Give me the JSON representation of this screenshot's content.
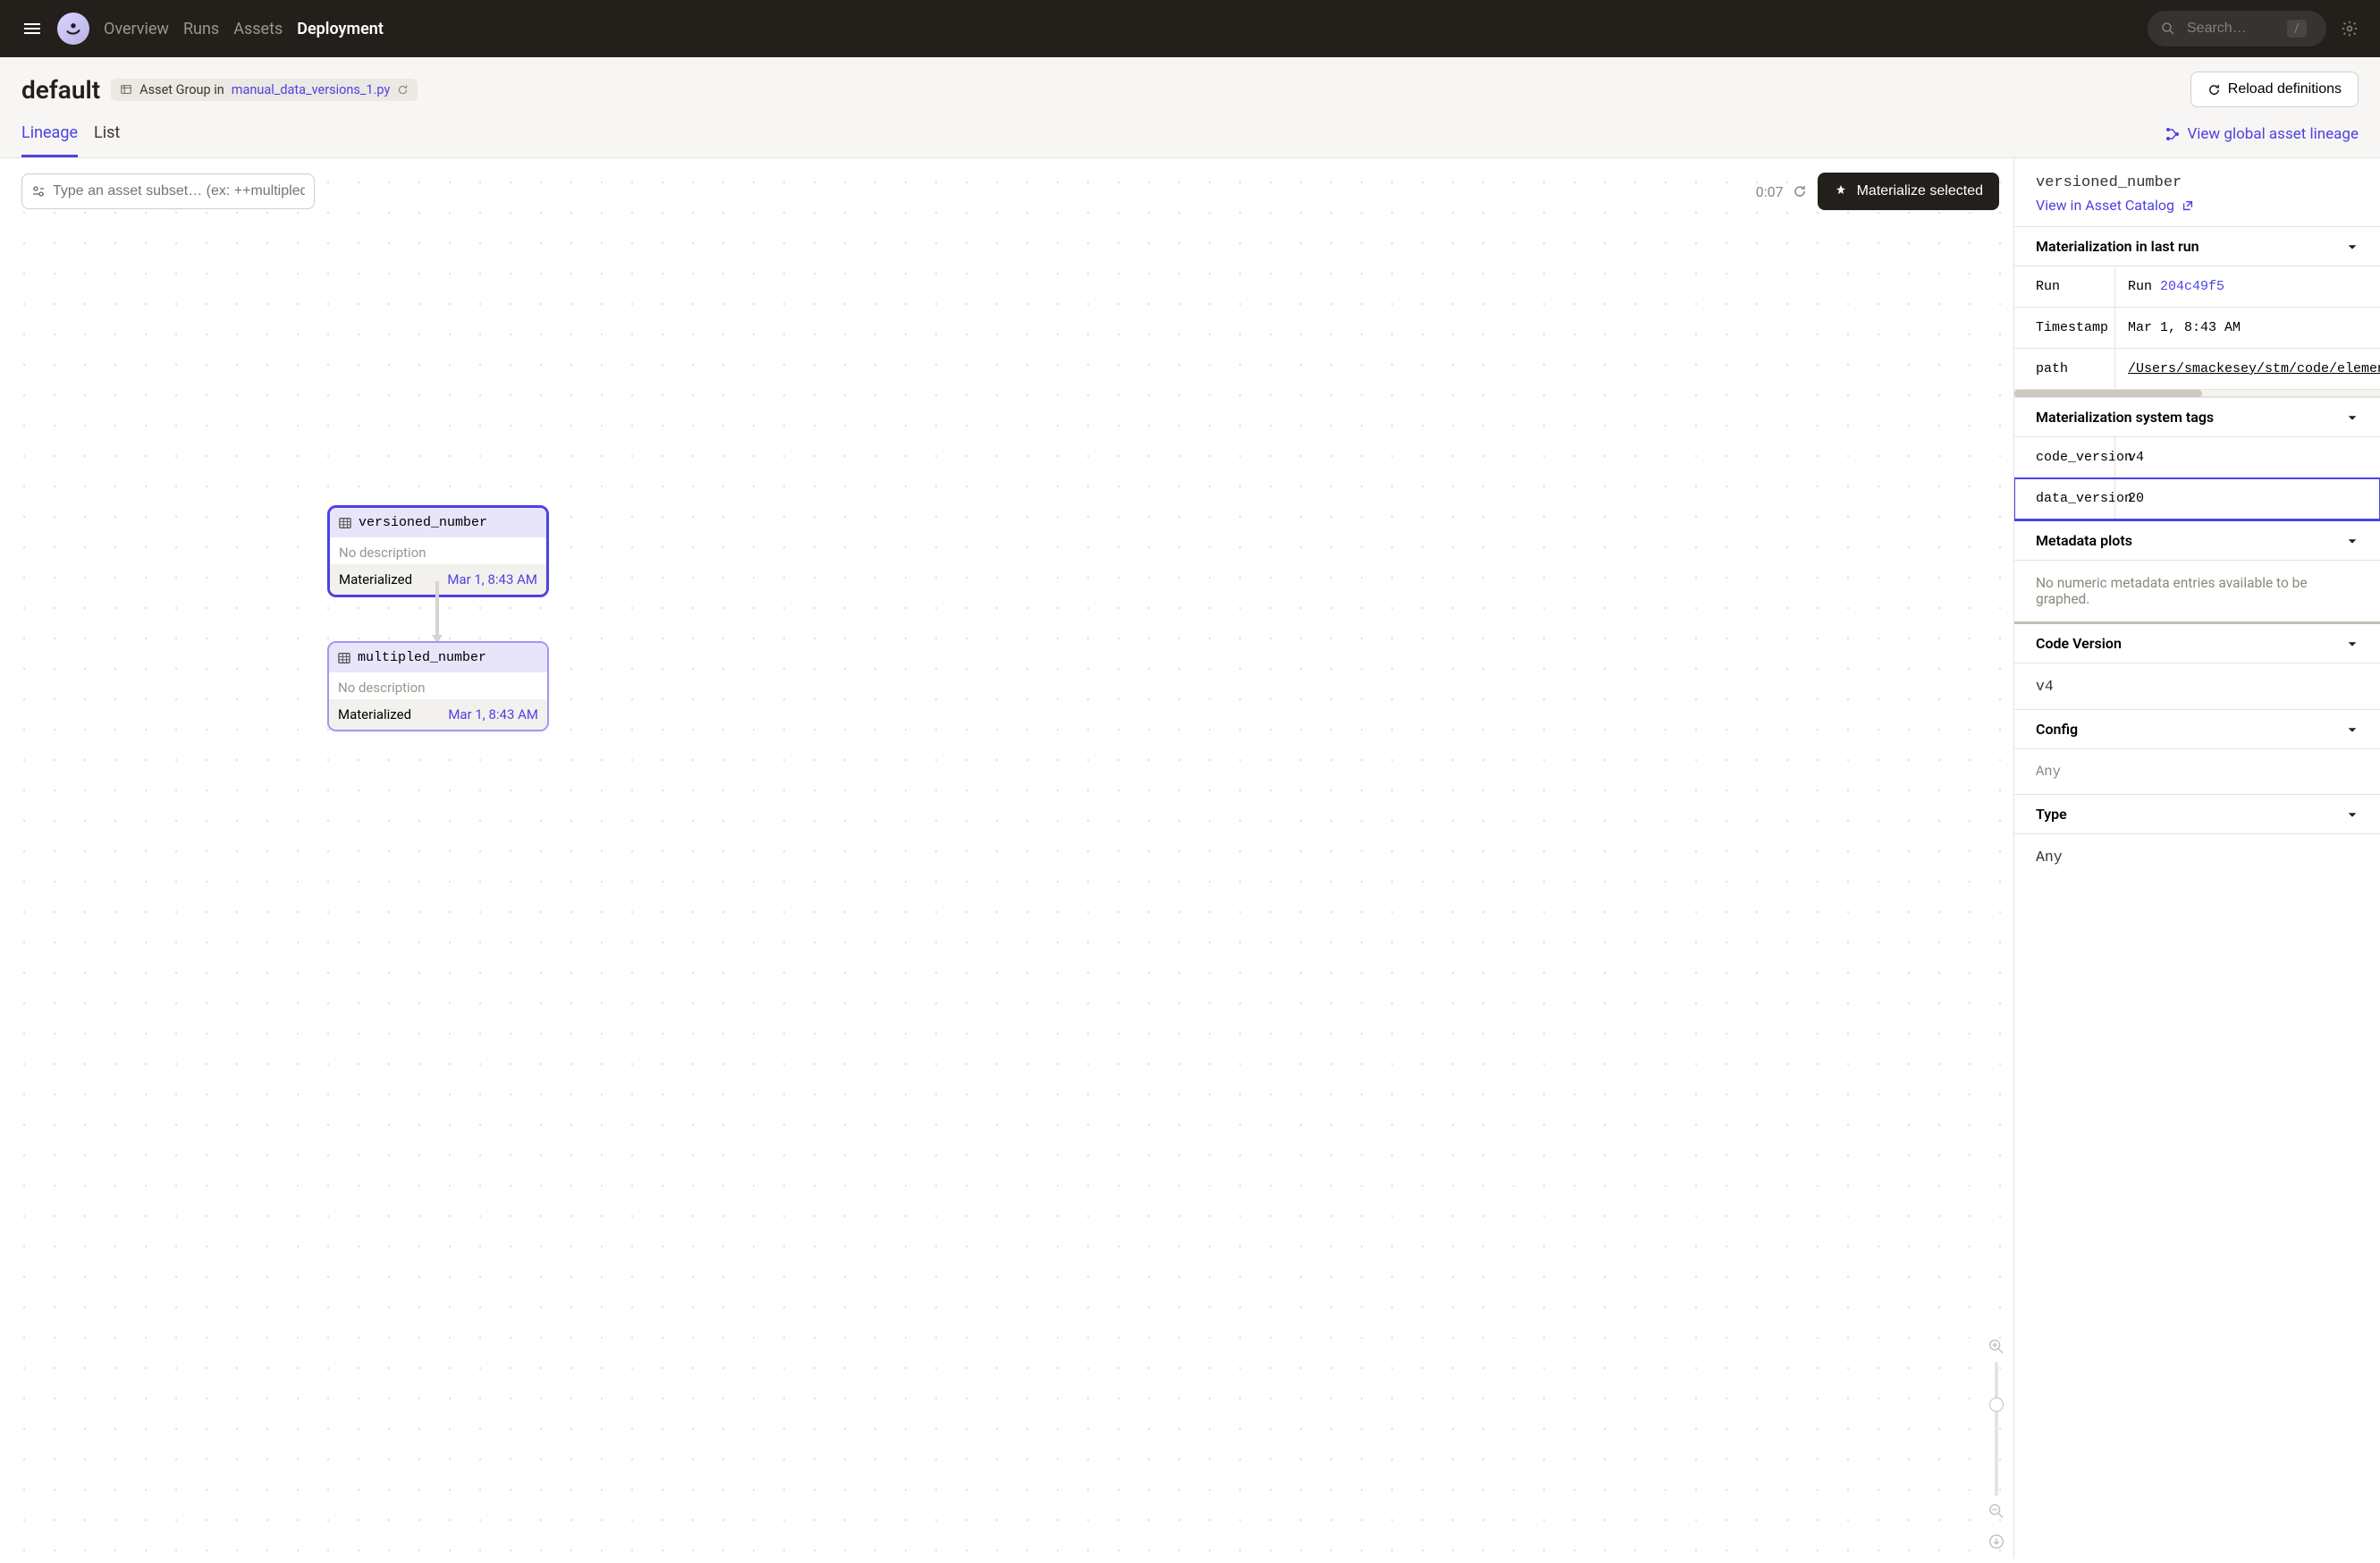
{
  "header": {
    "nav": {
      "overview": "Overview",
      "runs": "Runs",
      "assets": "Assets",
      "deployment": "Deployment"
    },
    "search_placeholder": "Search…",
    "slash": "/"
  },
  "subheader": {
    "title": "default",
    "asset_group_prefix": "Asset Group in ",
    "asset_group_file": "manual_data_versions_1.py",
    "reload_label": "Reload definitions",
    "tabs": {
      "lineage": "Lineage",
      "list": "List"
    },
    "global_lineage": "View global asset lineage"
  },
  "graph": {
    "subset_placeholder": "Type an asset subset… (ex: ++multipled_nu",
    "timer": "0:07",
    "materialize_label": "Materialize selected",
    "nodes": {
      "versioned": {
        "name": "versioned_number",
        "desc": "No description",
        "status": "Materialized",
        "time": "Mar 1, 8:43 AM"
      },
      "multipled": {
        "name": "multipled_number",
        "desc": "No description",
        "status": "Materialized",
        "time": "Mar 1, 8:43 AM"
      }
    }
  },
  "panel": {
    "title": "versioned_number",
    "catalog_link": "View in Asset Catalog",
    "sections": {
      "last_run": {
        "header": "Materialization in last run",
        "run_label": "Run",
        "run_prefix": "Run ",
        "run_id": "204c49f5",
        "ts_label": "Timestamp",
        "ts_value": "Mar 1, 8:43 AM",
        "path_label": "path",
        "path_value": "/Users/smackesey/stm/code/elementl/"
      },
      "sys_tags": {
        "header": "Materialization system tags",
        "code_version_k": "code_version",
        "code_version_v": "v4",
        "data_version_k": "data_version",
        "data_version_v": "20"
      },
      "plots": {
        "header": "Metadata plots",
        "empty": "No numeric metadata entries available to be graphed."
      },
      "code_version": {
        "header": "Code Version",
        "value": "v4"
      },
      "config": {
        "header": "Config",
        "value": "Any"
      },
      "type": {
        "header": "Type",
        "value": "Any"
      }
    }
  }
}
